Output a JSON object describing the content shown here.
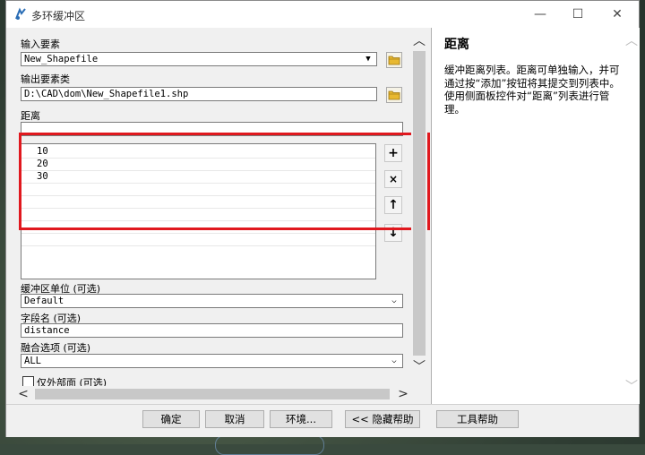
{
  "window": {
    "title": "多环缓冲区",
    "controls": {
      "minimize": "—",
      "maximize": "☐",
      "close": "✕"
    }
  },
  "form": {
    "input_label": "输入要素",
    "input_value": "New_Shapefile",
    "output_label": "输出要素类",
    "output_value": "D:\\CAD\\dom\\New_Shapefile1.shp",
    "distance_label": "距离",
    "distance_value": "",
    "distances": [
      "10",
      "20",
      "30"
    ],
    "list_buttons": {
      "add": "+",
      "remove": "×",
      "up": "↑",
      "down": "↓"
    },
    "unit_label": "缓冲区单位 (可选)",
    "unit_value": "Default",
    "field_label": "字段名 (可选)",
    "field_value": "distance",
    "dissolve_label": "融合选项 (可选)",
    "dissolve_value": "ALL",
    "outside_label": "仅外部面 (可选)"
  },
  "help": {
    "title": "距离",
    "text": "缓冲距离列表。距离可单独输入，并可通过按“添加”按钮将其提交到列表中。使用侧面板控件对“距离”列表进行管理。"
  },
  "buttons": {
    "ok": "确定",
    "cancel": "取消",
    "environments": "环境...",
    "hide_help": "<< 隐藏帮助",
    "tool_help": "工具帮助"
  },
  "colors": {
    "highlight": "#e0181e",
    "window_bg": "#f0f0f0"
  }
}
